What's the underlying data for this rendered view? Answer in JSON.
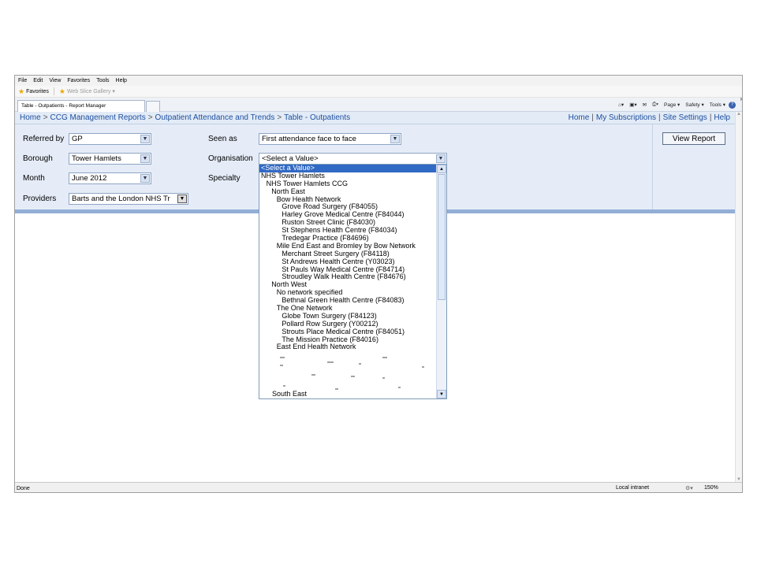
{
  "browser": {
    "menu": [
      "File",
      "Edit",
      "View",
      "Favorites",
      "Tools",
      "Help"
    ],
    "favorites_label": "Favorites",
    "web_slice_label": "Web Slice Gallery ▾",
    "tab_title": "Table - Outpatients - Report Manager",
    "commands": {
      "page": "Page ▾",
      "safety": "Safety ▾",
      "tools": "Tools ▾",
      "help_icon": "?"
    },
    "status": {
      "left": "Done",
      "zone": "Local intranet",
      "zoom": "150%"
    }
  },
  "breadcrumb": {
    "items": [
      "Home",
      "CCG Management Reports",
      "Outpatient Attendance and Trends",
      "Table - Outpatients"
    ],
    "separator": ">"
  },
  "top_links": [
    "Home",
    "My Subscriptions",
    "Site Settings",
    "Help"
  ],
  "top_links_separator": "|",
  "params": {
    "referred_by": {
      "label": "Referred by",
      "value": "GP"
    },
    "borough": {
      "label": "Borough",
      "value": "Tower Hamlets"
    },
    "month": {
      "label": "Month",
      "value": "June 2012"
    },
    "providers": {
      "label": "Providers",
      "value": "Barts and the London NHS Tr"
    },
    "seen_as": {
      "label": "Seen as",
      "value": "First attendance face to face"
    },
    "organisation": {
      "label": "Organisation",
      "value": "<Select a Value>"
    },
    "specialty": {
      "label": "Specialty"
    }
  },
  "view_report_label": "View Report",
  "organisation_options": [
    {
      "text": "<Select a Value>",
      "depth": 0,
      "selected": true
    },
    {
      "text": "NHS Tower Hamlets",
      "depth": 0
    },
    {
      "text": "NHS Tower Hamlets CCG",
      "depth": 1
    },
    {
      "text": "North East",
      "depth": 2
    },
    {
      "text": "Bow Health Network",
      "depth": 3
    },
    {
      "text": "Grove Road Surgery (F84055)",
      "depth": 4
    },
    {
      "text": "Harley Grove Medical Centre (F84044)",
      "depth": 4
    },
    {
      "text": "Ruston Street Clinic (F84030)",
      "depth": 4
    },
    {
      "text": "St Stephens Health Centre (F84034)",
      "depth": 4
    },
    {
      "text": "Tredegar Practice (F84696)",
      "depth": 4
    },
    {
      "text": "Mile End East and Bromley by Bow Network",
      "depth": 3
    },
    {
      "text": "Merchant Street Surgery (F84118)",
      "depth": 4
    },
    {
      "text": "St Andrews Health Centre (Y03023)",
      "depth": 4
    },
    {
      "text": "St Pauls Way Medical Centre (F84714)",
      "depth": 4
    },
    {
      "text": "Stroudley Walk Health Centre (F84676)",
      "depth": 4
    },
    {
      "text": "North West",
      "depth": 2
    },
    {
      "text": "No network specified",
      "depth": 3
    },
    {
      "text": "Bethnal Green Health Centre (F84083)",
      "depth": 4
    },
    {
      "text": "The One Network",
      "depth": 3
    },
    {
      "text": "Globe Town Surgery (F84123)",
      "depth": 4
    },
    {
      "text": "Pollard Row Surgery (Y00212)",
      "depth": 4
    },
    {
      "text": "Strouts Place Medical Centre (F84051)",
      "depth": 4
    },
    {
      "text": "The Mission Practice (F84016)",
      "depth": 4
    },
    {
      "text": "East End Health Network",
      "depth": 3
    }
  ],
  "organisation_last_option": "South East"
}
